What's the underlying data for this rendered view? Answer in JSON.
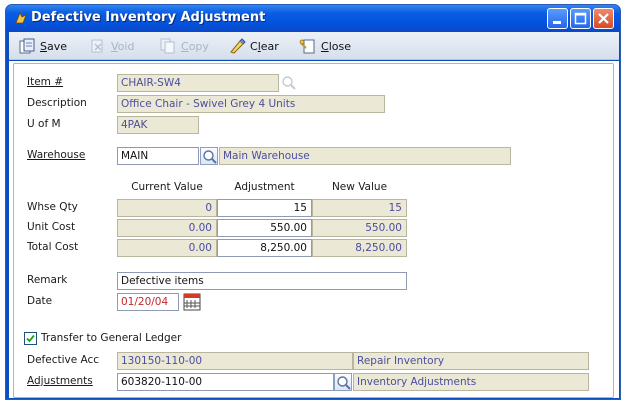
{
  "window": {
    "title": "Defective Inventory Adjustment"
  },
  "toolbar": {
    "save": {
      "label": "Save",
      "accel": "S",
      "rest": "ave",
      "icon": "save-icon"
    },
    "void": {
      "label": "Void",
      "accel": "V",
      "rest": "oid",
      "icon": "void-icon",
      "enabled": false
    },
    "copy": {
      "label": "Copy",
      "accel": "C",
      "rest": "opy",
      "icon": "copy-icon",
      "enabled": false
    },
    "clear": {
      "label": "Clear",
      "pre": "C",
      "accel": "l",
      "rest": "ear",
      "icon": "clear-icon"
    },
    "close": {
      "label": "Close",
      "accel": "C",
      "rest": "lose",
      "icon": "close-doc-icon"
    }
  },
  "item": {
    "item_label": "Item #",
    "item_value": "CHAIR-SW4",
    "description_label": "Description",
    "description_value": "Office Chair - Swivel Grey 4 Units",
    "uom_label": "U of M",
    "uom_value": "4PAK"
  },
  "warehouse": {
    "label": "Warehouse",
    "code": "MAIN",
    "name": "Main Warehouse"
  },
  "grid": {
    "headers": {
      "current": "Current Value",
      "adjustment": "Adjustment",
      "new": "New Value"
    },
    "rows": [
      {
        "label": "Whse Qty",
        "current": "0",
        "adjustment": "15",
        "new": "15"
      },
      {
        "label": "Unit Cost",
        "current": "0.00",
        "adjustment": "550.00",
        "new": "550.00"
      },
      {
        "label": "Total Cost",
        "current": "0.00",
        "adjustment": "8,250.00",
        "new": "8,250.00"
      }
    ]
  },
  "remark": {
    "label": "Remark",
    "value": "Defective items"
  },
  "date": {
    "label": "Date",
    "value": "01/20/04"
  },
  "gl": {
    "transfer_label": "Transfer to General Ledger",
    "transfer_checked": true,
    "defective_label": "Defective Acc",
    "defective_account": "130150-110-00",
    "defective_name": "Repair Inventory",
    "adjustments_label": "Adjustments",
    "adjustments_account": "603820-110-00",
    "adjustments_name": "Inventory Adjustments"
  },
  "colors": {
    "title_blue": "#0453dd",
    "readonly_fill": "#ece8d6",
    "readonly_text": "#4a4e9e",
    "date_text": "#c0282c"
  }
}
